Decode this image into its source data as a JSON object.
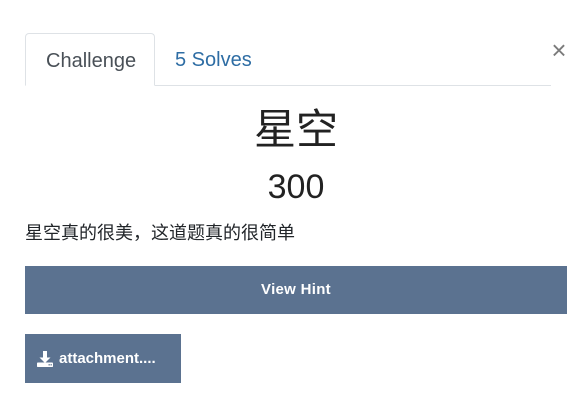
{
  "modal": {
    "close_glyph": "×",
    "tabs": [
      {
        "label": "Challenge"
      },
      {
        "label": "5 Solves"
      }
    ],
    "challenge": {
      "name": "星空",
      "points": "300",
      "description": "星空真的很美，这道题真的很简单"
    },
    "hint_button": {
      "label": "View Hint"
    },
    "file_button": {
      "label": "attachment....",
      "icon": "download-icon"
    }
  },
  "colors": {
    "button_bg": "#5b7290",
    "link": "#2e6da4",
    "tab_border": "#dee2e6"
  }
}
